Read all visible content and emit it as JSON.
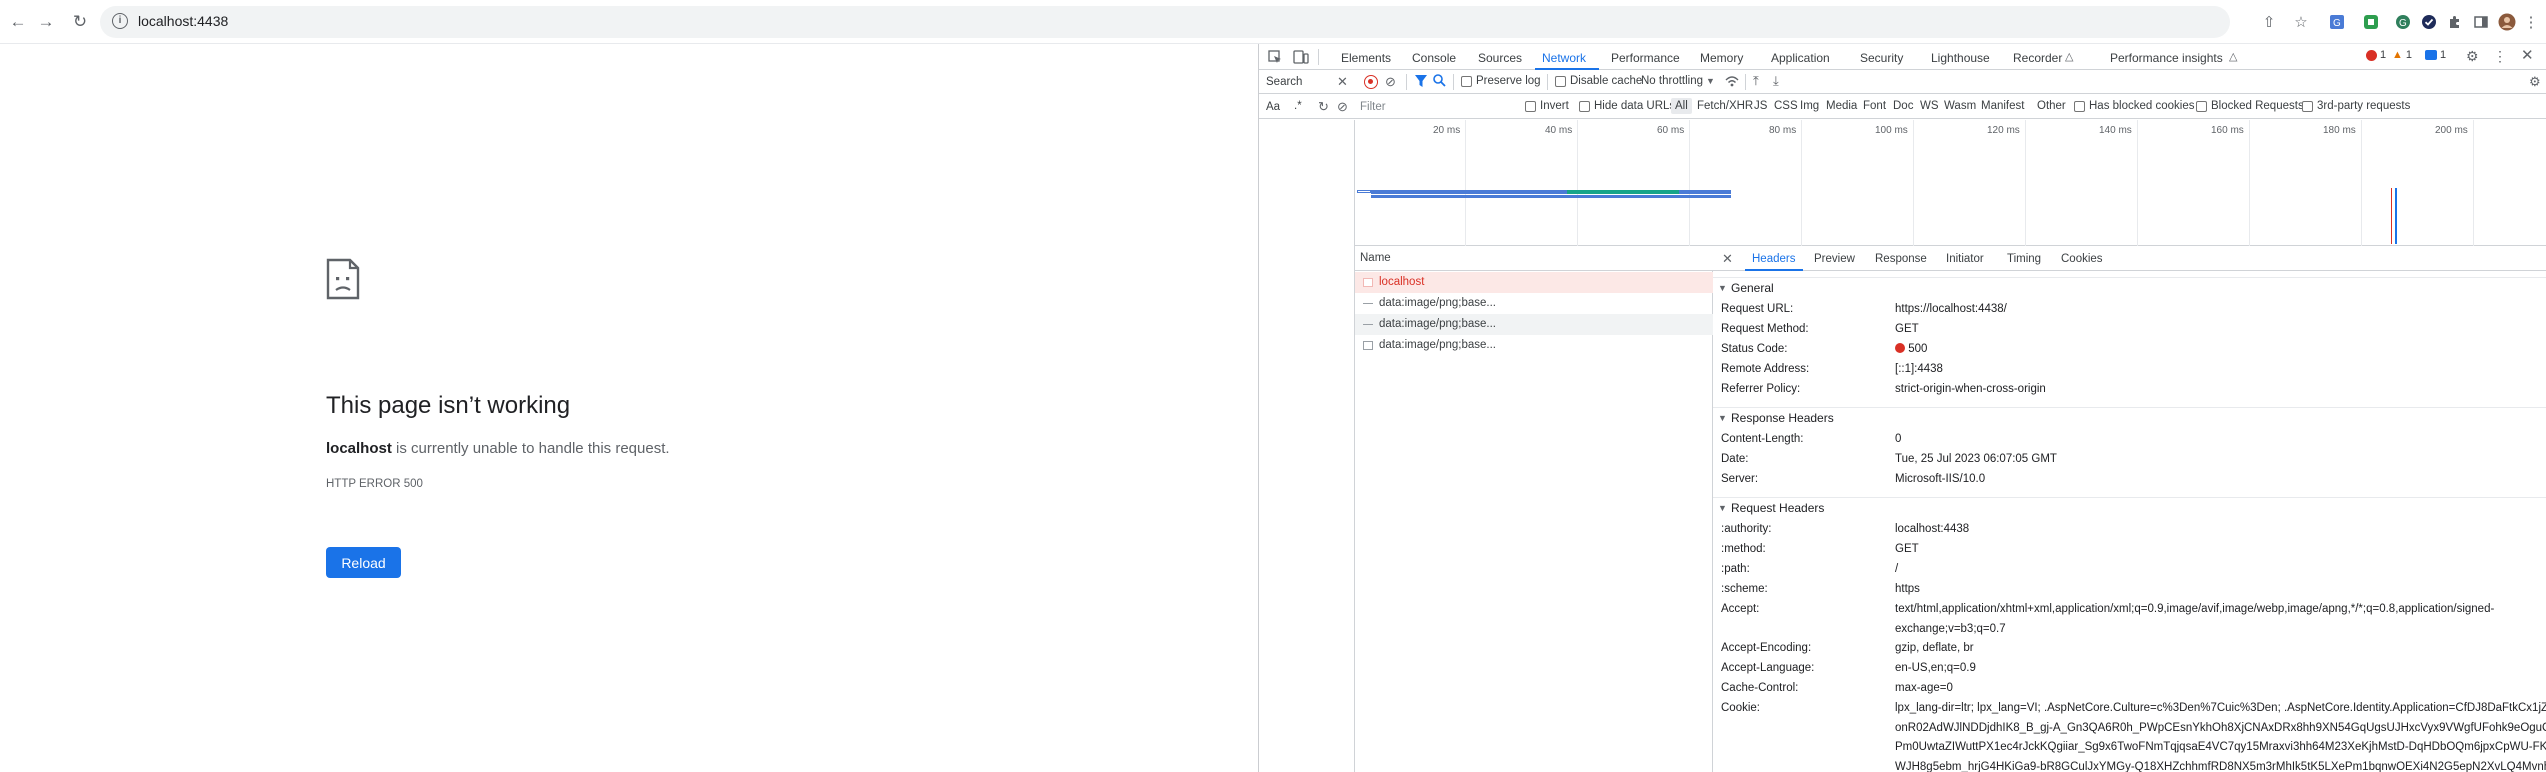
{
  "browser": {
    "url": "localhost:4438"
  },
  "error_page": {
    "title": "This page isn’t working",
    "host": "localhost",
    "message": "is currently unable to handle this request.",
    "code": "HTTP ERROR 500",
    "reload_label": "Reload"
  },
  "devtools": {
    "tabs": [
      "Elements",
      "Console",
      "Sources",
      "Network",
      "Performance",
      "Memory",
      "Application",
      "Security",
      "Lighthouse",
      "Recorder",
      "Performance insights"
    ],
    "active_tab": "Network",
    "badges": {
      "errors": "1",
      "warnings": "1",
      "issues": "1"
    },
    "search_label": "Search",
    "toolbar": {
      "preserve_log": "Preserve log",
      "disable_cache": "Disable cache",
      "throttling": "No throttling"
    },
    "aa_label": "Aa",
    "regex_label": ".*",
    "filter": {
      "placeholder": "Filter",
      "invert": "Invert",
      "hide_data_urls": "Hide data URLs",
      "types": [
        "All",
        "Fetch/XHR",
        "JS",
        "CSS",
        "Img",
        "Media",
        "Font",
        "Doc",
        "WS",
        "Wasm",
        "Manifest",
        "Other"
      ],
      "blocked_cookies": "Has blocked cookies",
      "blocked_requests": "Blocked Requests",
      "third_party": "3rd-party requests"
    },
    "timeline_ticks": [
      "20 ms",
      "40 ms",
      "60 ms",
      "80 ms",
      "100 ms",
      "120 ms",
      "140 ms",
      "160 ms",
      "180 ms",
      "200 ms"
    ],
    "requests": {
      "name_header": "Name",
      "rows": [
        {
          "name": "localhost",
          "error": true
        },
        {
          "name": "data:image/png;base...",
          "error": false
        },
        {
          "name": "data:image/png;base...",
          "error": false
        },
        {
          "name": "data:image/png;base...",
          "error": false
        }
      ]
    },
    "detail_tabs": [
      "Headers",
      "Preview",
      "Response",
      "Initiator",
      "Timing",
      "Cookies"
    ],
    "active_detail_tab": "Headers",
    "general": {
      "title": "General",
      "items": [
        {
          "k": "Request URL:",
          "v": "https://localhost:4438/"
        },
        {
          "k": "Request Method:",
          "v": "GET"
        },
        {
          "k": "Status Code:",
          "v": "500"
        },
        {
          "k": "Remote Address:",
          "v": "[::1]:4438"
        },
        {
          "k": "Referrer Policy:",
          "v": "strict-origin-when-cross-origin"
        }
      ]
    },
    "response_headers": {
      "title": "Response Headers",
      "items": [
        {
          "k": "Content-Length:",
          "v": "0"
        },
        {
          "k": "Date:",
          "v": "Tue, 25 Jul 2023 06:07:05 GMT"
        },
        {
          "k": "Server:",
          "v": "Microsoft-IIS/10.0"
        }
      ]
    },
    "request_headers": {
      "title": "Request Headers",
      "items": [
        {
          "k": ":authority:",
          "v": "localhost:4438"
        },
        {
          "k": ":method:",
          "v": "GET"
        },
        {
          "k": ":path:",
          "v": "/"
        },
        {
          "k": ":scheme:",
          "v": "https"
        },
        {
          "k": "Accept:",
          "v": "text/html,application/xhtml+xml,application/xml;q=0.9,image/avif,image/webp,image/apng,*/*;q=0.8,application/signed-exchange;v=b3;q=0.7"
        },
        {
          "k": "Accept-Encoding:",
          "v": "gzip, deflate, br"
        },
        {
          "k": "Accept-Language:",
          "v": "en-US,en;q=0.9"
        },
        {
          "k": "Cache-Control:",
          "v": "max-age=0"
        },
        {
          "k": "Cookie:",
          "v": "lpx_lang-dir=ltr; lpx_lang=VI; .AspNetCore.Culture=c%3Den%7Cuic%3Den; .AspNetCore.Identity.Application=CfDJ8DaFtkCx1jZIionR02AdWJlNDDjdhIK8_B_gj-A_Gn3QA6R0h_PWpCEsnYkhOh8XjCNAxDRx8hh9XN54GqUgsUJHxcVyx9VWgfUFohk9eOguCPm0UwtaZIWuttPX1ec4rJckKQgiiar_Sg9x6TwoFNmTqjqsaE4VC7qy15Mraxvi3hh64M23XeKjhMstD-DqHDbOQm6jpxCpWU-FKWJH8g5ebm_hrjG4HKiGa9-bR8GCulJxYMGy-Q18XHZchhmfRD8NX5m3rMhIk5tK5LXePm1bqnwOEXi4N2G5epN2XvLQ4MvnhmBUnKzpEfyn4-"
        }
      ]
    }
  },
  "colors": {
    "accent": "#1a73e8",
    "error_red": "#d93025",
    "error_row_bg": "#fce8e6"
  }
}
